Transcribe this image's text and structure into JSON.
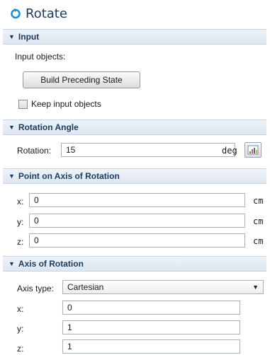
{
  "title": "Rotate",
  "sections": {
    "input": {
      "header": "Input",
      "input_objects_label": "Input objects:",
      "build_button": "Build Preceding State",
      "keep_input_label": "Keep input objects"
    },
    "rotation_angle": {
      "header": "Rotation Angle",
      "rotation_label": "Rotation:",
      "rotation_value": "15",
      "unit": "deg"
    },
    "point_on_axis": {
      "header": "Point on Axis of Rotation",
      "x_label": "x:",
      "x_value": "0",
      "y_label": "y:",
      "y_value": "0",
      "z_label": "z:",
      "z_value": "0",
      "unit": "cm"
    },
    "axis_of_rotation": {
      "header": "Axis of Rotation",
      "axis_type_label": "Axis type:",
      "axis_type_value": "Cartesian",
      "x_label": "x:",
      "x_value": "0",
      "y_label": "y:",
      "y_value": "1",
      "z_label": "z:",
      "z_value": "1"
    }
  },
  "icons": {
    "title": "rotate-icon",
    "collapse": "triangle-down-icon",
    "plot": "plot-icon",
    "dropdown": "chevron-down-icon"
  },
  "colors": {
    "accent": "#1b3a5c",
    "header_bg": "#dde6f1",
    "rotate_icon": "#1e8fd6"
  }
}
